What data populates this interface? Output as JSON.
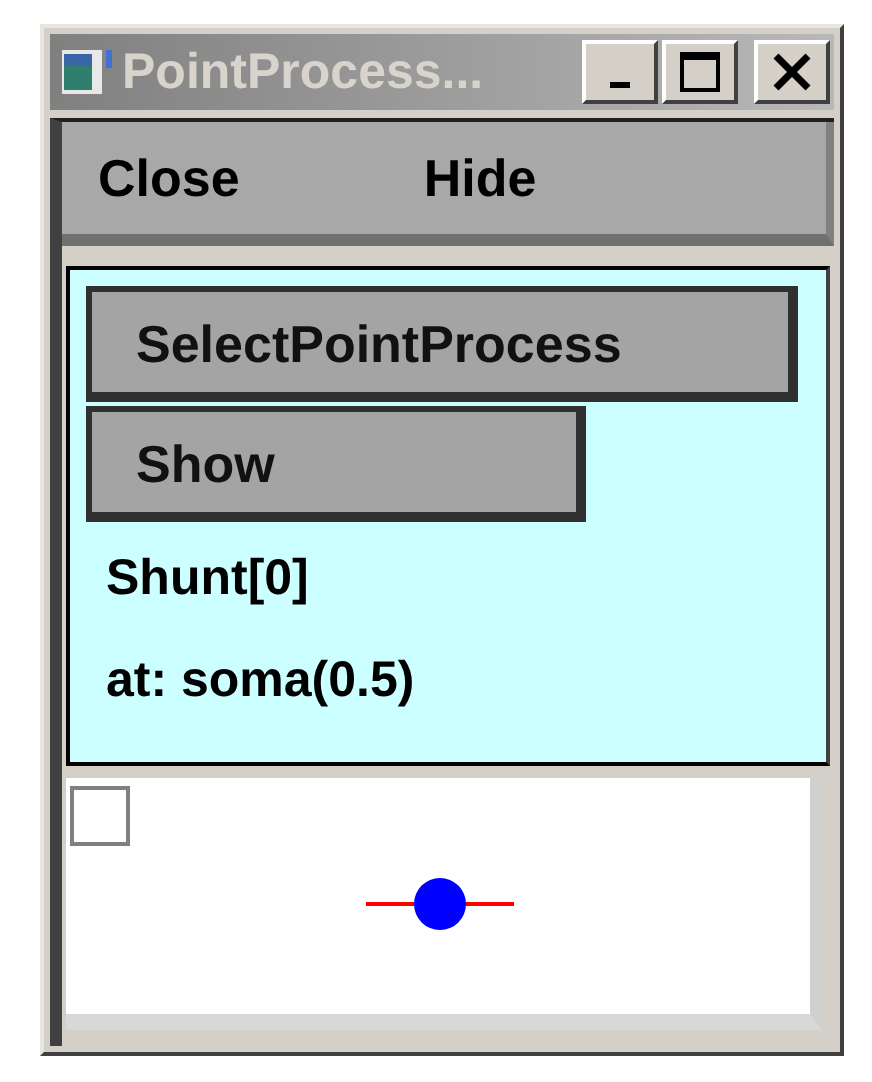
{
  "window": {
    "title": "PointProcess..."
  },
  "menu": [
    {
      "label": "Close"
    },
    {
      "label": "Hide"
    }
  ],
  "panel": {
    "buttons": [
      {
        "label": "SelectPointProcess"
      },
      {
        "label": "Show"
      }
    ],
    "labels": [
      "Shunt[0]",
      "at: soma(0.5)"
    ]
  }
}
